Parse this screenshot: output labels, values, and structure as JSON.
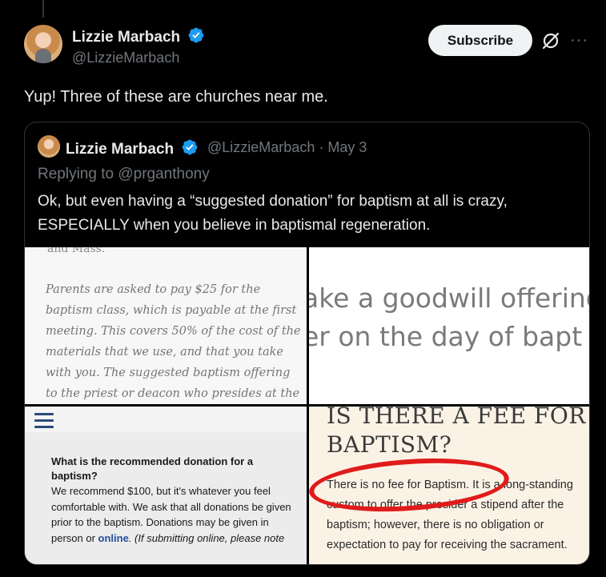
{
  "post": {
    "author_name": "Lizzie Marbach",
    "handle": "@LizzieMarbach",
    "subscribe_label": "Subscribe",
    "text": "Yup! Three of these are churches near me."
  },
  "quoted": {
    "author_name": "Lizzie Marbach",
    "handle": "@LizzieMarbach",
    "separator": "·",
    "date": "May 3",
    "replying_prefix": "Replying to ",
    "replying_to": "@prganthony",
    "body_line1": "Ok, but even having a “suggested donation” for baptism at all is crazy,",
    "body_line2": "ESPECIALLY when you believe in baptismal regeneration."
  },
  "media": {
    "img1": {
      "top_fragment": "and Mass.",
      "paragraph": "Parents are asked to pay $25 for the baptism class, which is payable at the first meeting. This covers 50% of the cost of the materials that we use, and that you take with you. The suggested baptism offering to the priest or deacon who presides at the"
    },
    "img2": {
      "line1": "ake a goodwill offering",
      "line2": "er on the day of bapt"
    },
    "img3": {
      "question": "What is the recommended donation for a baptism?",
      "answer_pre": "We recommend $100, but it's whatever you feel comfortable with. We ask that all donations be given prior to the baptism. Donations may be given in person or ",
      "answer_link": "online",
      "answer_post": ". (If submitting online, please note"
    },
    "img4": {
      "heading": "IS THERE A FEE FOR BAPTISM?",
      "body": "There is no fee for Baptism.  It is a long-standing custom to offer the presider a stipend after the baptism; however, there is no obligation or expectation to pay for receiving the sacrament."
    }
  },
  "colors": {
    "background": "#000000",
    "verified": "#1d9bf0",
    "secondary_text": "#71767b",
    "annotation_circle": "#e01b1b"
  }
}
